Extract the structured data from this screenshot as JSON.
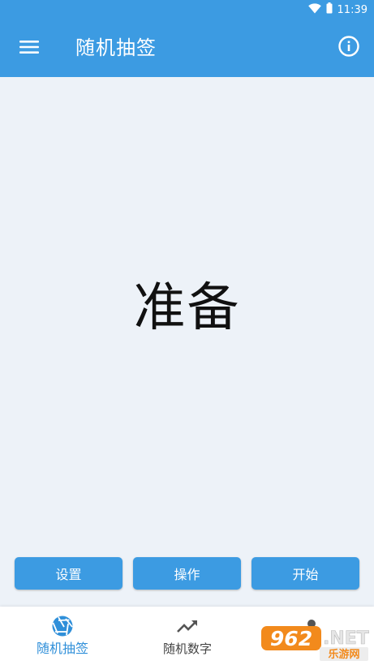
{
  "status_bar": {
    "time": "11:39",
    "icons": [
      "wifi-icon",
      "battery-icon"
    ]
  },
  "toolbar": {
    "title": "随机抽签",
    "menu_icon": "hamburger-menu-icon",
    "info_icon": "info-icon"
  },
  "main": {
    "display_text": "准备"
  },
  "actions": {
    "settings_label": "设置",
    "operate_label": "操作",
    "start_label": "开始"
  },
  "bottom_nav": {
    "items": [
      {
        "label": "随机抽签",
        "icon": "aperture-icon",
        "active": true
      },
      {
        "label": "随机数字",
        "icon": "trending-up-icon",
        "active": false
      },
      {
        "label": "",
        "icon": "person-icon",
        "active": false
      }
    ]
  },
  "watermark": {
    "brand": "962.NET",
    "caption": "乐游网"
  },
  "colors": {
    "primary": "#3c9be2",
    "background": "#edf2f8",
    "active_nav": "#2f8fd9"
  }
}
